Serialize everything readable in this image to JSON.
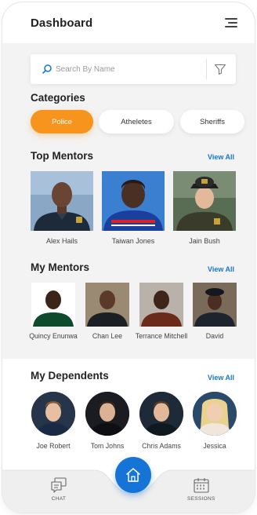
{
  "header": {
    "title": "Dashboard",
    "menu_icon": "hamburger-menu-icon"
  },
  "search": {
    "placeholder": "Search By Name",
    "icon": "search-icon",
    "filter_icon": "filter-icon"
  },
  "categories": {
    "title": "Categories",
    "chips": [
      {
        "label": "Police",
        "active": true
      },
      {
        "label": "Atheletes",
        "active": false
      },
      {
        "label": "Sheriffs",
        "active": false
      }
    ]
  },
  "top_mentors": {
    "title": "Top Mentors",
    "view_all": "View All",
    "items": [
      {
        "name": "Alex Hails"
      },
      {
        "name": "Taiwan Jones"
      },
      {
        "name": "Jain Bush"
      }
    ]
  },
  "my_mentors": {
    "title": "My Mentors",
    "view_all": "View All",
    "items": [
      {
        "name": "Quincy Enunwa"
      },
      {
        "name": "Chan Lee"
      },
      {
        "name": "Terrance Mitchell"
      },
      {
        "name": "David"
      }
    ]
  },
  "my_dependents": {
    "title": "My Dependents",
    "view_all": "View All",
    "items": [
      {
        "name": "Joe Robert"
      },
      {
        "name": "Tom Johns"
      },
      {
        "name": "Chris Adams"
      },
      {
        "name": "Jessica"
      }
    ]
  },
  "bottom_nav": {
    "chat_label": "CHAT",
    "sessions_label": "SESSIONS",
    "home_icon": "home-icon"
  },
  "colors": {
    "accent_orange": "#f7941d",
    "accent_blue": "#1674d6",
    "background": "#f3f3f3"
  }
}
